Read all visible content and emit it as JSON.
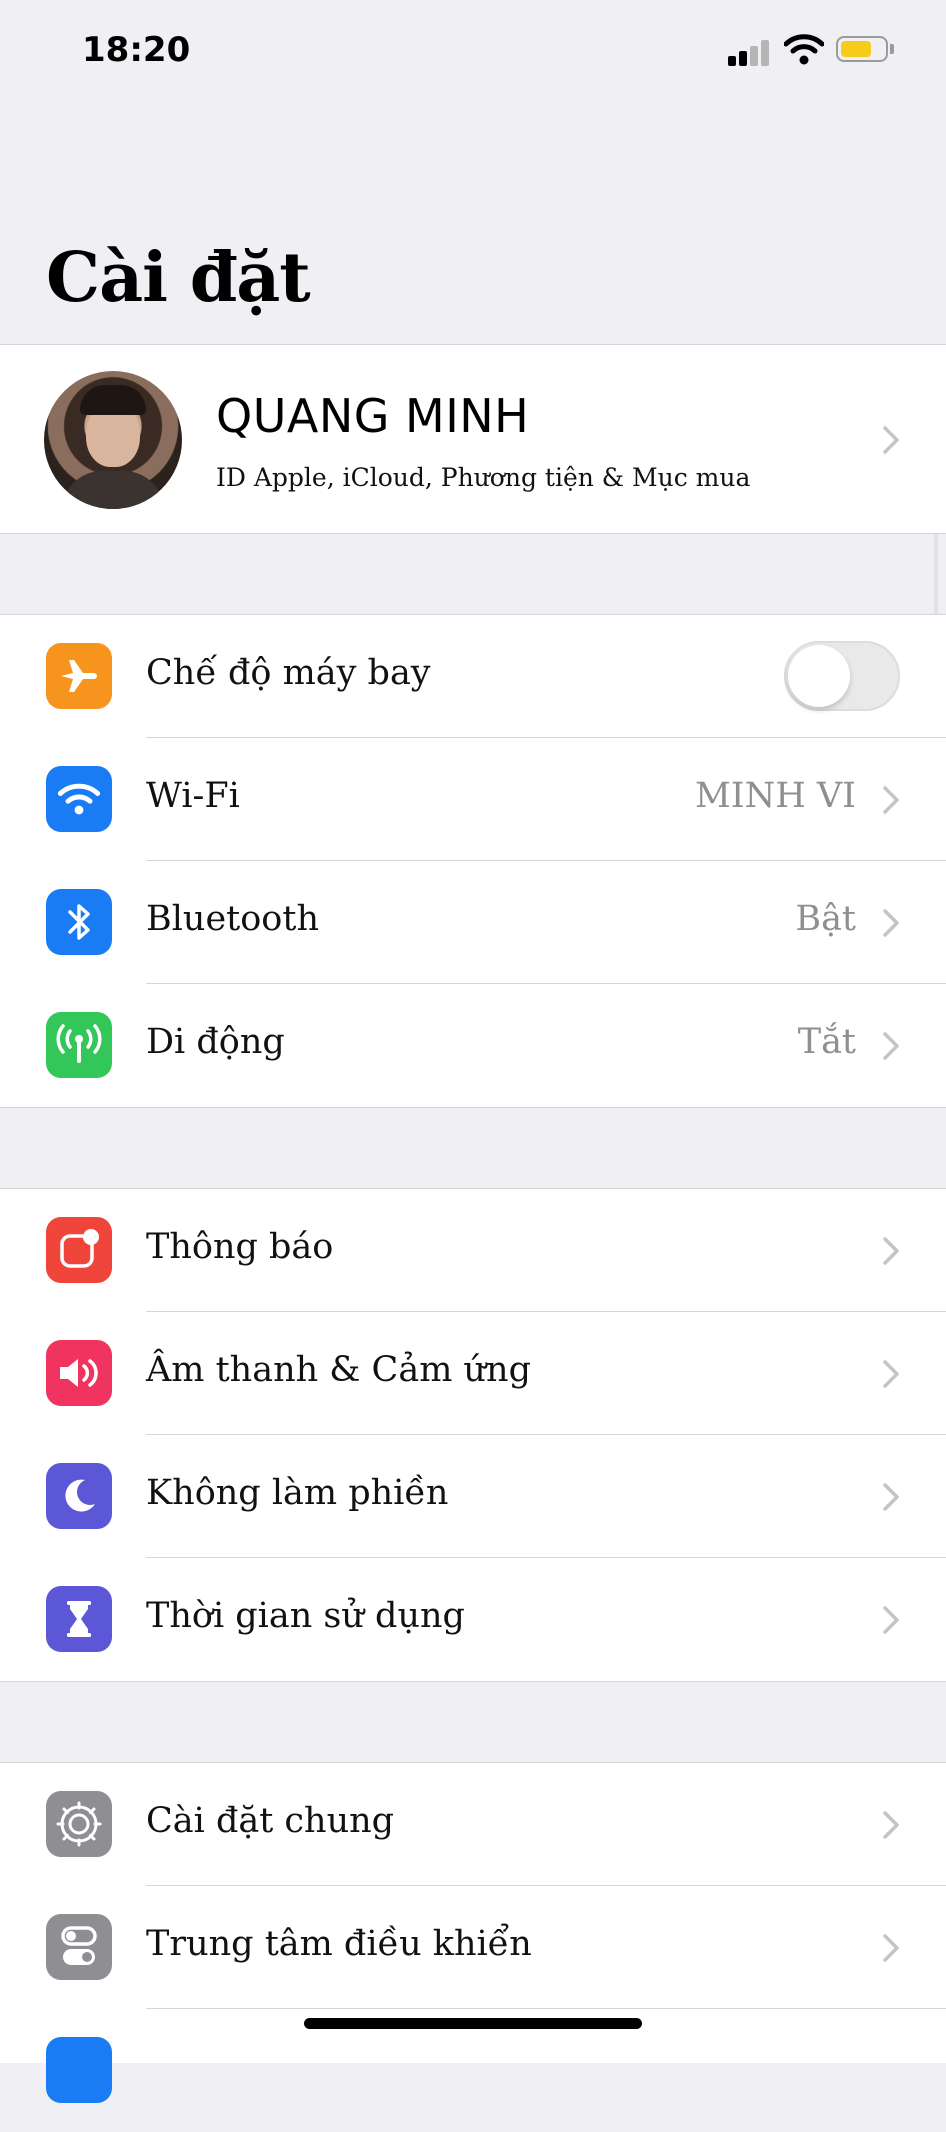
{
  "status_bar": {
    "time": "18:20"
  },
  "page": {
    "title": "Cài đặt"
  },
  "profile": {
    "name": "QUANG MINH",
    "subtitle": "ID Apple, iCloud, Phương tiện & Mục mua"
  },
  "connectivity": {
    "airplane": {
      "label": "Chế độ máy bay",
      "icon": "airplane-icon",
      "color": "#f7941d",
      "enabled": false
    },
    "wifi": {
      "label": "Wi-Fi",
      "value": "MINH VI",
      "icon": "wifi-icon",
      "color": "#1a7cf5"
    },
    "bluetooth": {
      "label": "Bluetooth",
      "value": "Bật",
      "icon": "bluetooth-icon",
      "color": "#1a7cf5"
    },
    "cellular": {
      "label": "Di động",
      "value": "Tắt",
      "icon": "cellular-antenna-icon",
      "color": "#33c759"
    }
  },
  "notifications_group": {
    "notifications": {
      "label": "Thông báo",
      "icon": "notifications-icon",
      "color": "#f0453a"
    },
    "sounds": {
      "label": "Âm thanh & Cảm ứng",
      "icon": "speaker-icon",
      "color": "#f0345f"
    },
    "dnd": {
      "label": "Không làm phiền",
      "icon": "moon-icon",
      "color": "#5b57d6"
    },
    "screen_time": {
      "label": "Thời gian sử dụng",
      "icon": "hourglass-icon",
      "color": "#5b57d6"
    }
  },
  "general_group": {
    "general": {
      "label": "Cài đặt chung",
      "icon": "gear-icon",
      "color": "#8e8e93"
    },
    "control_center": {
      "label": "Trung tâm điều khiển",
      "icon": "control-center-icon",
      "color": "#8e8e93"
    }
  }
}
